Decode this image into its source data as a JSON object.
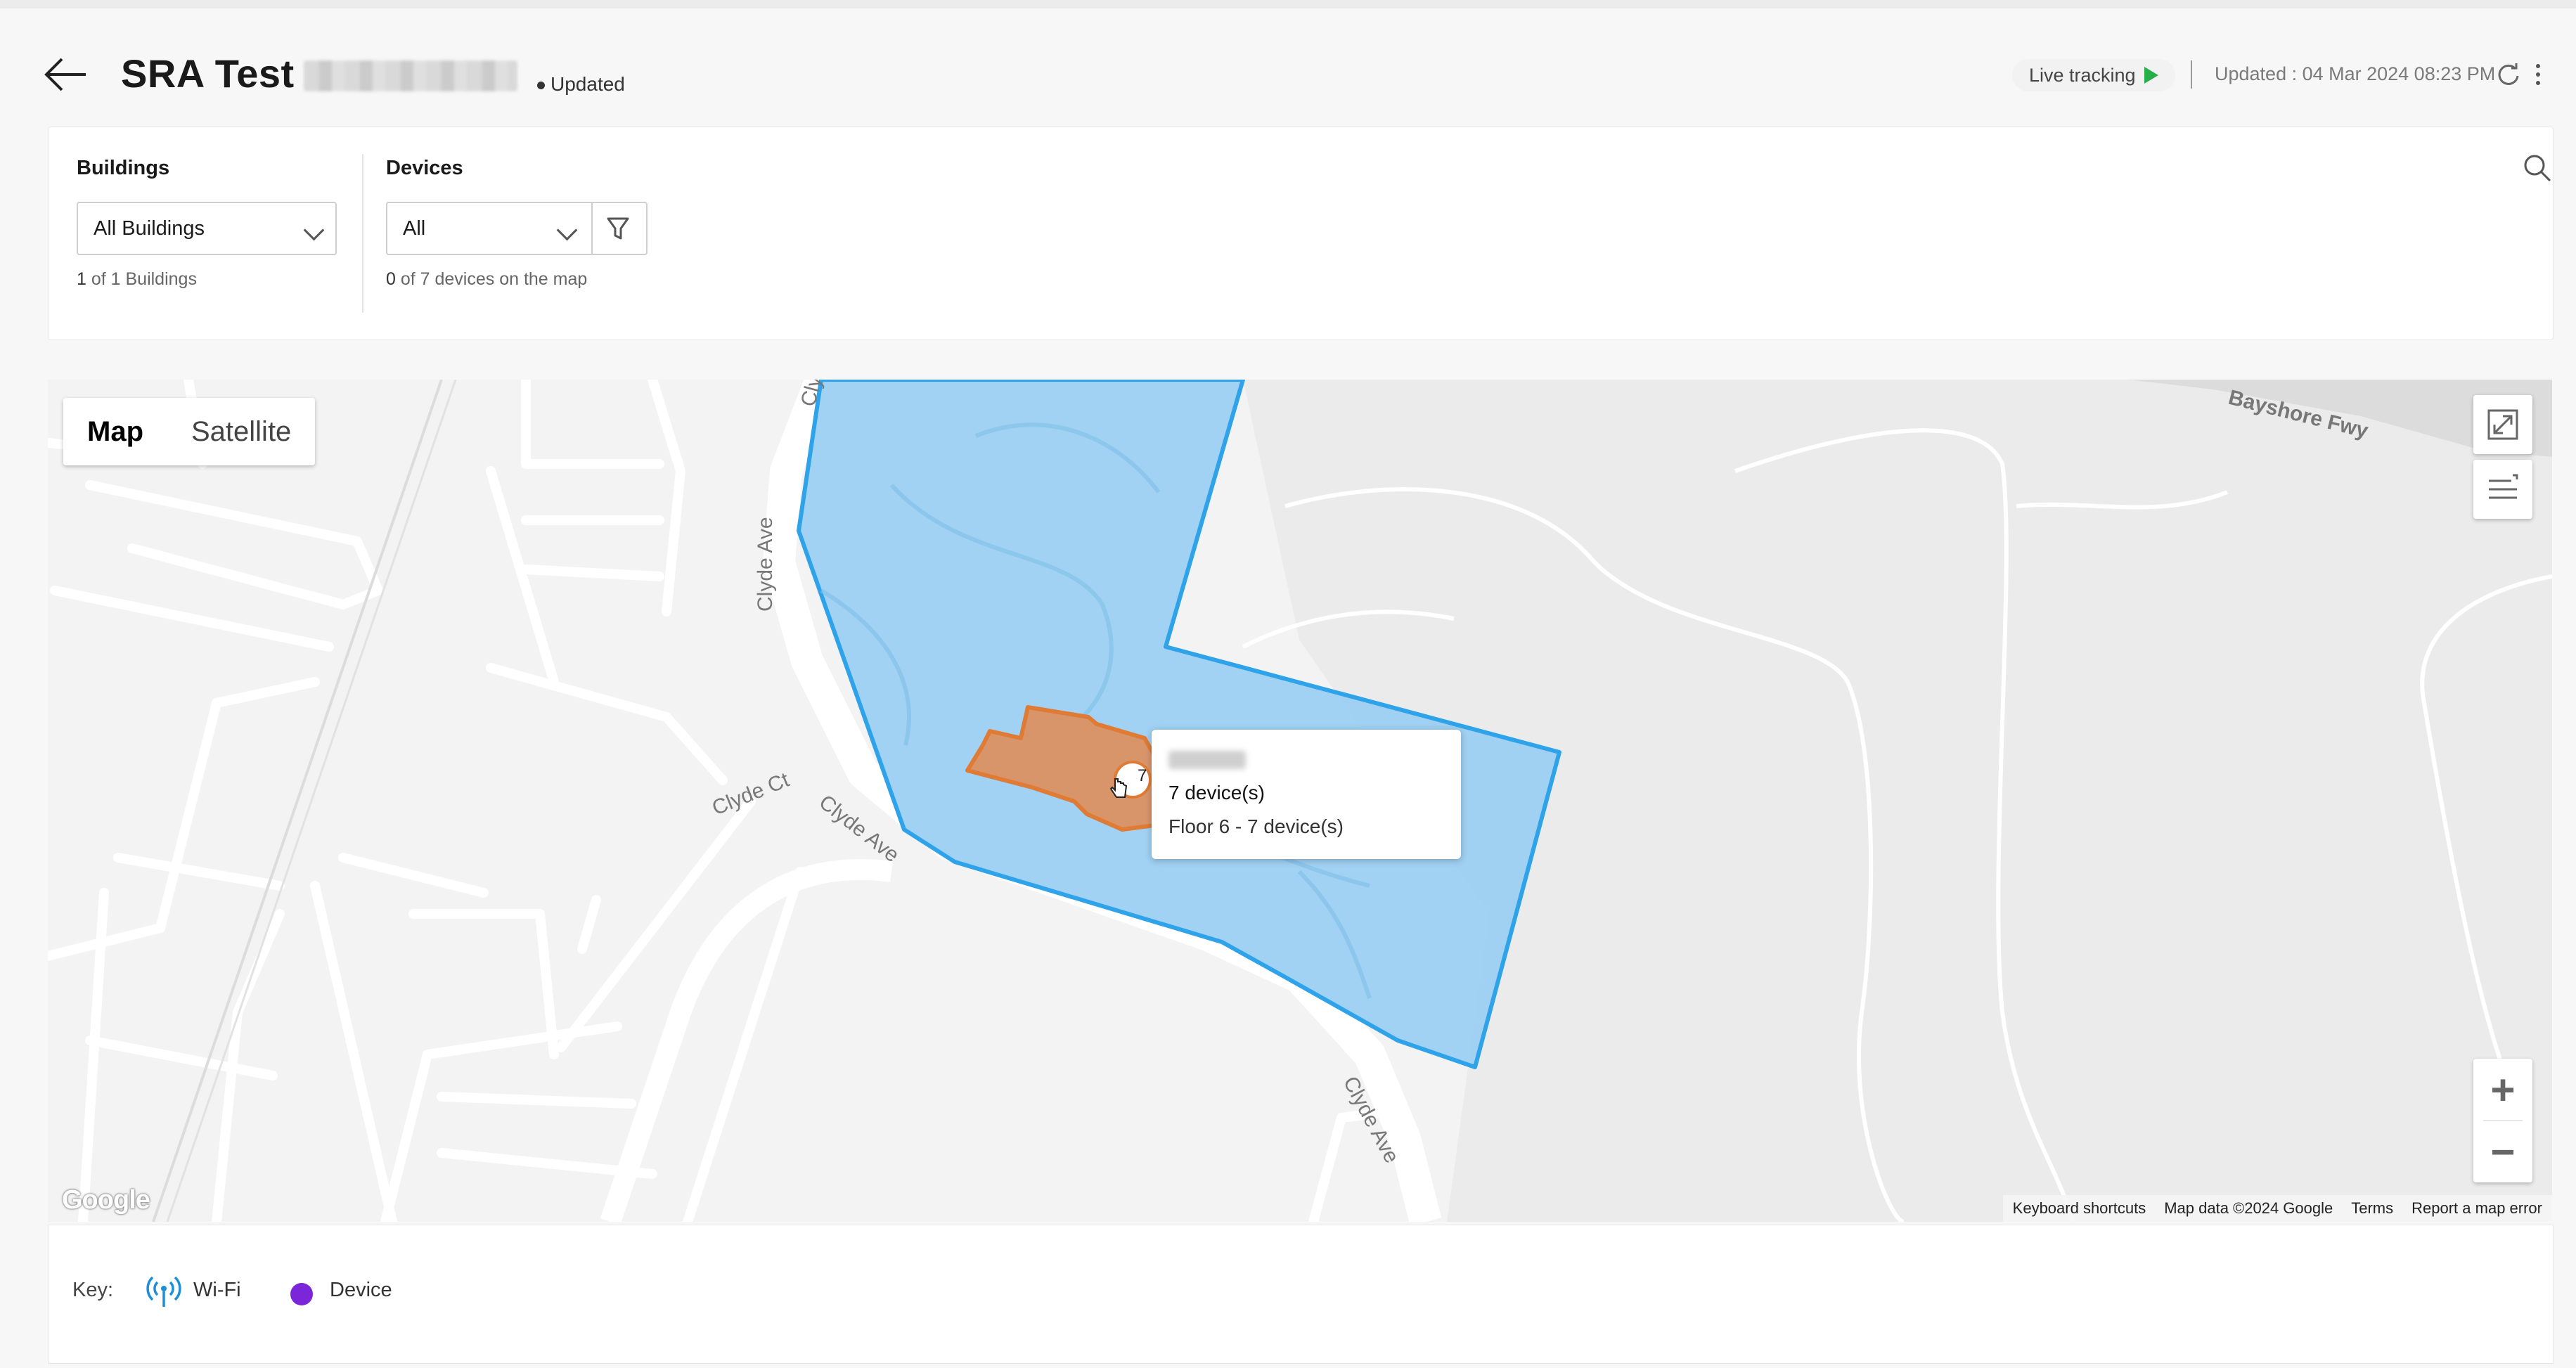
{
  "header": {
    "title": "SRA Test",
    "status": "Updated",
    "live_tracking_label": "Live tracking",
    "updated_time": "Updated : 04 Mar 2024 08:23 PM"
  },
  "filters": {
    "buildings_label": "Buildings",
    "buildings_value": "All Buildings",
    "buildings_count_num": "1",
    "buildings_count_rest": " of 1 Buildings",
    "devices_label": "Devices",
    "devices_value": "All",
    "devices_count_num": "0",
    "devices_count_rest": " of 7 devices on the map"
  },
  "map": {
    "map_type_options": [
      "Map",
      "Satellite"
    ],
    "selected_map_type": "Map",
    "street_labels": [
      "Clyde Ave",
      "Clyde Ct",
      "Clyde Ave",
      "Clyde Ave",
      "Clyde",
      "Bayshore Fwy"
    ],
    "marker_count": "7",
    "tooltip": {
      "devices_text": "7 device(s)",
      "floor_text": "Floor 6 - 7 device(s)"
    },
    "zoom_in": "+",
    "zoom_out": "−",
    "google_logo": "Google",
    "attribution": [
      "Keyboard shortcuts",
      "Map data ©2024 Google",
      "Terms",
      "Report a map error"
    ],
    "colors": {
      "site_fill": "#9ccff2",
      "site_stroke": "#2fa3ea",
      "building_fill": "#d9956a",
      "building_stroke": "#e07b36"
    }
  },
  "key": {
    "label": "Key:",
    "wifi_label": "Wi-Fi",
    "device_label": "Device",
    "device_color": "#7b26d9",
    "wifi_color": "#1d8fd8"
  }
}
